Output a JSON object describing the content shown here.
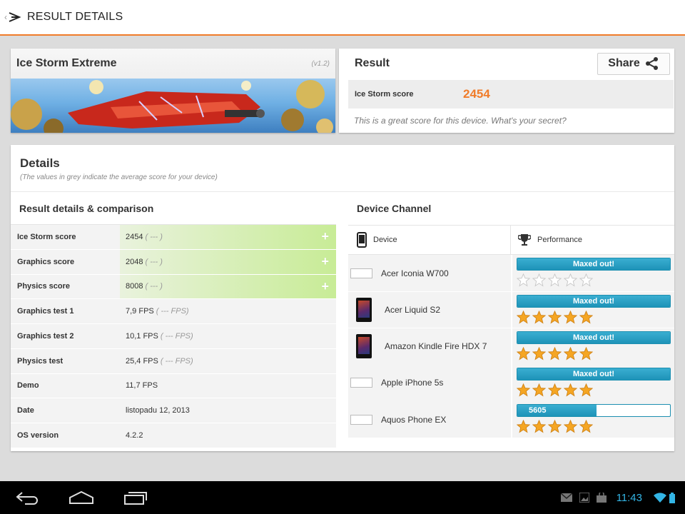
{
  "topbar": {
    "title": "RESULT DETAILS"
  },
  "benchmark": {
    "name": "Ice Storm Extreme",
    "version": "(v1.2)"
  },
  "result": {
    "title": "Result",
    "share_label": "Share",
    "score_label": "Ice Storm score",
    "score_value": "2454",
    "message": "This is a great score for this device. What's your secret?"
  },
  "details": {
    "title": "Details",
    "subtitle": "(The values in grey indicate the average score for your device)",
    "comparison_title": "Result details & comparison",
    "rows": [
      {
        "label": "Ice Storm score",
        "value": "2454",
        "avg": "( --- )"
      },
      {
        "label": "Graphics score",
        "value": "2048",
        "avg": "( --- )"
      },
      {
        "label": "Physics score",
        "value": "8008",
        "avg": "( --- )"
      },
      {
        "label": "Graphics test 1",
        "value": "7,9 FPS",
        "avg": "( --- FPS)"
      },
      {
        "label": "Graphics test 2",
        "value": "10,1 FPS",
        "avg": "( --- FPS)"
      },
      {
        "label": "Physics test",
        "value": "25,4 FPS",
        "avg": "( --- FPS)"
      },
      {
        "label": "Demo",
        "value": "11,7 FPS",
        "avg": ""
      },
      {
        "label": "Date",
        "value": "listopadu 12, 2013",
        "avg": ""
      },
      {
        "label": "OS version",
        "value": "4.2.2",
        "avg": ""
      }
    ]
  },
  "device_channel": {
    "title": "Device Channel",
    "device_header": "Device",
    "performance_header": "Performance",
    "devices": [
      {
        "name": "Acer Iconia W700",
        "bar_label": "Maxed out!",
        "fill": 1.0,
        "stars": 0
      },
      {
        "name": "Acer Liquid S2",
        "bar_label": "Maxed out!",
        "fill": 1.0,
        "stars": 5
      },
      {
        "name": "Amazon Kindle Fire HDX 7",
        "bar_label": "Maxed out!",
        "fill": 1.0,
        "stars": 5
      },
      {
        "name": "Apple iPhone 5s",
        "bar_label": "Maxed out!",
        "fill": 1.0,
        "stars": 5
      },
      {
        "name": "Aquos Phone EX",
        "bar_label": "5605",
        "fill": 0.52,
        "stars": 5
      }
    ]
  },
  "statusbar": {
    "time": "11:43"
  },
  "colors": {
    "accent": "#f07c2a",
    "bar": "#1e93b8",
    "star": "#f5a623",
    "status": "#33b5e5"
  }
}
